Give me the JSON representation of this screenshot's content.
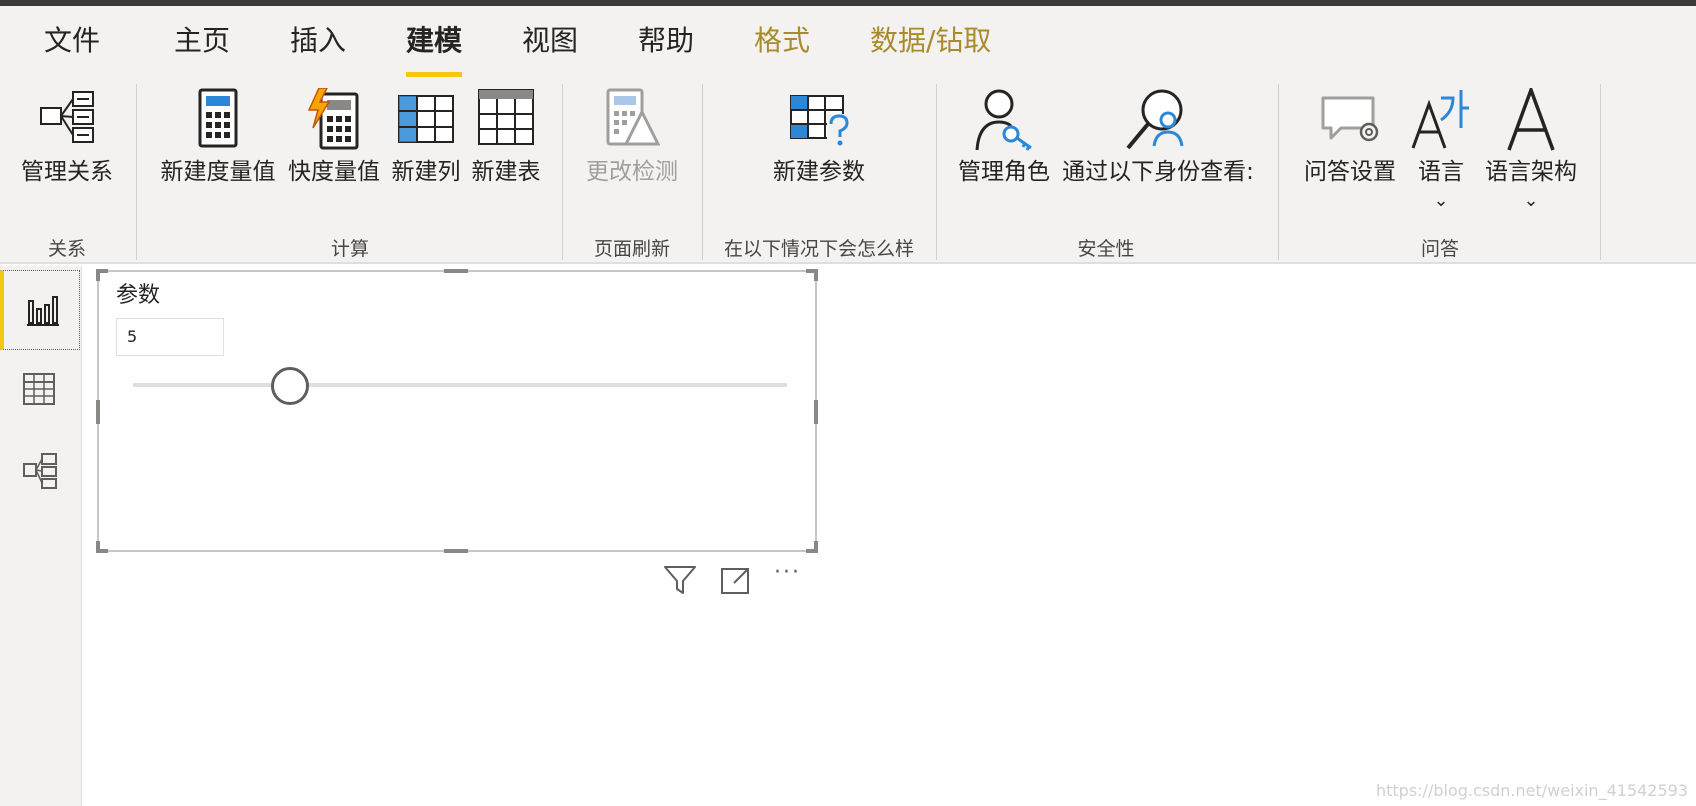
{
  "tabs": [
    {
      "label": "文件"
    },
    {
      "label": "主页"
    },
    {
      "label": "插入"
    },
    {
      "label": "建模"
    },
    {
      "label": "视图"
    },
    {
      "label": "帮助"
    },
    {
      "label": "格式"
    },
    {
      "label": "数据/钻取"
    }
  ],
  "active_tab": "建模",
  "ribbon": {
    "manage_relationships": "管理关系",
    "new_measure": "新建度量值",
    "quick_measure": "快度量值",
    "new_column": "新建列",
    "new_table": "新建表",
    "change_detection": "更改检测",
    "new_parameter": "新建参数",
    "manage_roles": "管理角色",
    "view_as": "通过以下身份查看:",
    "qa_setup": "问答设置",
    "language": "语言",
    "linguistic_schema": "语言架构",
    "chevron": "⌄",
    "groups": {
      "relationships": "关系",
      "calculations": "计算",
      "page_refresh": "页面刷新",
      "what_if": "在以下情况下会怎么样",
      "security": "安全性",
      "qa": "问答"
    }
  },
  "rail": {
    "report_view": "report-view",
    "data_view": "data-view",
    "model_view": "model-view"
  },
  "slicer": {
    "title": "参数",
    "value": "5",
    "level_fraction": 0.24
  },
  "visual_header": {
    "filter": "filter-icon",
    "focus": "focus-mode-icon",
    "more": "···"
  },
  "watermark": "https://blog.csdn.net/weixin_41542593",
  "colors": {
    "accent": "#f2c811",
    "contextual_tab": "#a88b2b",
    "icon_blue": "#2b88d8",
    "icon_orange": "#f7a600"
  }
}
